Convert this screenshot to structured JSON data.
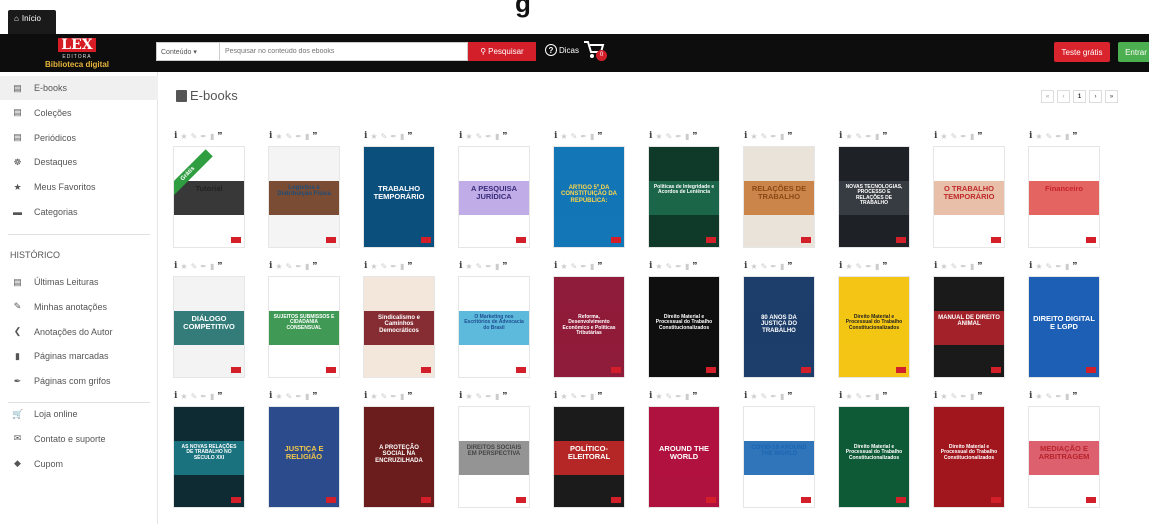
{
  "top": {
    "home_tab": "Início",
    "cut_title": "g"
  },
  "header": {
    "logo_lex": "LEX",
    "logo_editora": "EDITORA",
    "logo_subtitle": "Biblioteca digital",
    "search_category": "Conteúdo",
    "search_placeholder": "Pesquisar no conteúdo dos ebooks",
    "search_button": "Pesquisar",
    "tips_label": "Dicas",
    "cart_count": "0",
    "trial_button": "Teste grátis",
    "login_button": "Entrar"
  },
  "sidebar": {
    "items": [
      {
        "label": "E-books",
        "icon": "book-icon"
      },
      {
        "label": "Coleções",
        "icon": "book-icon"
      },
      {
        "label": "Periódicos",
        "icon": "book-icon"
      },
      {
        "label": "Destaques",
        "icon": "award-icon"
      },
      {
        "label": "Meus Favoritos",
        "icon": "star-icon"
      },
      {
        "label": "Categorias",
        "icon": "folder-icon"
      }
    ],
    "history_heading": "HISTÓRICO",
    "history_items": [
      {
        "label": "Últimas Leituras",
        "icon": "book-icon"
      },
      {
        "label": "Minhas anotações",
        "icon": "edit-icon"
      },
      {
        "label": "Anotações do Autor",
        "icon": "share-icon"
      },
      {
        "label": "Páginas marcadas",
        "icon": "bookmark-icon"
      },
      {
        "label": "Páginas com grifos",
        "icon": "pen-icon"
      }
    ],
    "extra_items": [
      {
        "label": "Loja online",
        "icon": "cart-icon"
      },
      {
        "label": "Contato e suporte",
        "icon": "envelope-icon"
      },
      {
        "label": "Cupom",
        "icon": "tag-icon"
      }
    ]
  },
  "main": {
    "title": "E-books",
    "pager": {
      "first": "«",
      "prev": "‹",
      "current": "1",
      "next": "›",
      "last": "»"
    }
  },
  "books": [
    {
      "title": "Tutorial",
      "ribbon": "Grátis",
      "bg": "#ffffff",
      "fg": "#222222",
      "band": "#222222"
    },
    {
      "title": "Logística e Distribuição Física",
      "bg": "#f4f4f4",
      "fg": "#1f4c7a",
      "band": "#6b3a1e"
    },
    {
      "title": "TRABALHO TEMPORÁRIO",
      "bg": "#0b4f7d",
      "fg": "#ffffff",
      "band": "#0b4f7d"
    },
    {
      "title": "A PESQUISA JURÍDICA",
      "bg": "#ffffff",
      "fg": "#3a2a7a",
      "band": "#b9a4e4"
    },
    {
      "title": "ARTIGO 5º DA CONSTITUIÇÃO DA REPÚBLICA:",
      "bg": "#1376b6",
      "fg": "#ffd84a",
      "band": "#1376b6"
    },
    {
      "title": "Políticas de Integridade e Acordos de Leniência",
      "bg": "#0f3a2a",
      "fg": "#ffffff",
      "band": "#1d6b4b"
    },
    {
      "title": "RELAÇÕES DE TRABALHO",
      "bg": "#e9e3da",
      "fg": "#8a4a14",
      "band": "#c8793a"
    },
    {
      "title": "NOVAS TECNOLOGIAS, PROCESSO E RELAÇÕES DE TRABALHO",
      "bg": "#1e2126",
      "fg": "#ffffff",
      "band": "#3a3f46"
    },
    {
      "title": "O TRABALHO TEMPORÁRIO",
      "bg": "#ffffff",
      "fg": "#c0292b",
      "band": "#e6b9a0"
    },
    {
      "title": "Financeiro",
      "bg": "#ffffff",
      "fg": "#c7242b",
      "band": "#e0534f"
    },
    {
      "title": "DIÁLOGO COMPETITIVO",
      "bg": "#f3f3f3",
      "fg": "#ffffff",
      "band": "#1f6f6d"
    },
    {
      "title": "SUJEITOS SUBMISSOS E CIDADANIA CONSENSUAL",
      "bg": "#ffffff",
      "fg": "#ffffff",
      "band": "#2b8f43"
    },
    {
      "title": "Sindicalismo e Caminhos Democráticos",
      "bg": "#f3e6da",
      "fg": "#ffffff",
      "band": "#7a1820"
    },
    {
      "title": "O Marketing nos Escritórios de Advocacia do Brasil",
      "bg": "#ffffff",
      "fg": "#1e4b8f",
      "band": "#4bb3d8"
    },
    {
      "title": "Reforma, Desenvolvimento Econômico e Políticas Tributárias",
      "bg": "#8f1c3a",
      "fg": "#ffffff",
      "band": "#8f1c3a"
    },
    {
      "title": "Direito Material e Processual do Trabalho Constitucionalizados",
      "bg": "#0f0f0f",
      "fg": "#ffffff",
      "band": "#0f0f0f"
    },
    {
      "title": "80 ANOS DA JUSTIÇA DO TRABALHO",
      "bg": "#1d3d6a",
      "fg": "#ffffff",
      "band": "#1d3d6a"
    },
    {
      "title": "Direito Material e Processual do Trabalho Constitucionalizados",
      "bg": "#f4c514",
      "fg": "#222222",
      "band": "#f4c514"
    },
    {
      "title": "MANUAL DE DIREITO ANIMAL",
      "bg": "#1a1a1a",
      "fg": "#ffffff",
      "band": "#b3222b"
    },
    {
      "title": "DIREITO DIGITAL E LGPD",
      "bg": "#1d5fb5",
      "fg": "#ffffff",
      "band": "#1d5fb5"
    },
    {
      "title": "AS NOVAS RELAÇÕES DE TRABALHO NO SÉCULO XXI",
      "bg": "#0e2b33",
      "fg": "#ffffff",
      "band": "#1c7a86"
    },
    {
      "title": "JUSTIÇA E RELIGIÃO",
      "bg": "#2c4b8c",
      "fg": "#f0c74a",
      "band": "#2c4b8c"
    },
    {
      "title": "A PROTEÇÃO SOCIAL NA ENCRUZILHADA",
      "bg": "#6b1d1d",
      "fg": "#ffffff",
      "band": "#6b1d1d"
    },
    {
      "title": "DIREITOS SOCIAIS EM PERSPECTIVA",
      "bg": "#ffffff",
      "fg": "#444444",
      "band": "#888888"
    },
    {
      "title": "POLÍTICO-ELEITORAL",
      "bg": "#1b1b1b",
      "fg": "#ffffff",
      "band": "#c62828"
    },
    {
      "title": "AROUND THE WORLD",
      "bg": "#b0123f",
      "fg": "#ffffff",
      "band": "#b0123f"
    },
    {
      "title": "COVID-19 AROUND THE WORLD",
      "bg": "#ffffff",
      "fg": "#1a66b3",
      "band": "#1a66b3"
    },
    {
      "title": "Direito Material e Processual do Trabalho Constitucionalizados",
      "bg": "#0f5a36",
      "fg": "#ffffff",
      "band": "#0f5a36"
    },
    {
      "title": "Direito Material e Processual do Trabalho Constitucionalizados",
      "bg": "#a1151d",
      "fg": "#ffffff",
      "band": "#a1151d"
    },
    {
      "title": "MEDIAÇÃO E ARBITRAGEM",
      "bg": "#ffffff",
      "fg": "#b8242b",
      "band": "#d94f5e"
    }
  ]
}
